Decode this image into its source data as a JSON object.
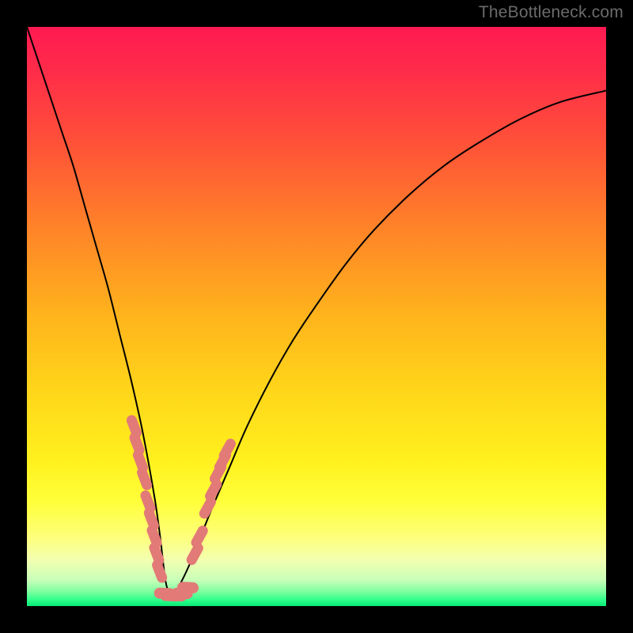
{
  "watermark": "TheBottleneck.com",
  "gradient_stops": [
    {
      "offset": 0,
      "color": "#ff1a52"
    },
    {
      "offset": 0.07,
      "color": "#ff2a4a"
    },
    {
      "offset": 0.2,
      "color": "#ff5138"
    },
    {
      "offset": 0.35,
      "color": "#ff8428"
    },
    {
      "offset": 0.5,
      "color": "#ffb41c"
    },
    {
      "offset": 0.63,
      "color": "#ffd61a"
    },
    {
      "offset": 0.75,
      "color": "#fff11e"
    },
    {
      "offset": 0.82,
      "color": "#ffff3a"
    },
    {
      "offset": 0.88,
      "color": "#feff7a"
    },
    {
      "offset": 0.92,
      "color": "#f3ffb0"
    },
    {
      "offset": 0.955,
      "color": "#c8ffb8"
    },
    {
      "offset": 0.975,
      "color": "#7dffa0"
    },
    {
      "offset": 0.99,
      "color": "#2cff8a"
    },
    {
      "offset": 1.0,
      "color": "#08e874"
    }
  ],
  "curve_color": "#000000",
  "curve_width": 2.0,
  "marker_color": "#e27a77",
  "chart_data": {
    "type": "line",
    "title": "",
    "xlabel": "",
    "ylabel": "",
    "xlim": [
      0,
      100
    ],
    "ylim": [
      0,
      100
    ],
    "notes": "Axes unlabeled; values are percent of plot width/height estimated from pixels. Vertical gradient encodes y-value (red high → green low). Single black curve descends from top-left corner to a minimum near x≈24 then rises asymptotically toward upper right. Salmon markers cluster along the curve near the bottom.",
    "series": [
      {
        "name": "curve",
        "x": [
          0,
          2,
          4,
          6,
          8,
          10,
          12,
          14,
          16,
          18,
          20,
          22,
          23,
          24,
          25,
          26,
          28,
          30,
          32,
          35,
          38,
          42,
          46,
          50,
          55,
          60,
          66,
          72,
          78,
          85,
          92,
          100
        ],
        "y": [
          100,
          94,
          88,
          82,
          76,
          69,
          62,
          55,
          47,
          39,
          30,
          19,
          12,
          4,
          2,
          3,
          7,
          12,
          17,
          24,
          31,
          39,
          46,
          52,
          59,
          65,
          71,
          76,
          80,
          84,
          87,
          89
        ]
      }
    ],
    "markers_left": [
      {
        "x": 18.5,
        "y": 31
      },
      {
        "x": 19.0,
        "y": 28
      },
      {
        "x": 19.6,
        "y": 25
      },
      {
        "x": 20.3,
        "y": 22
      },
      {
        "x": 20.9,
        "y": 18
      },
      {
        "x": 21.5,
        "y": 15
      },
      {
        "x": 22.0,
        "y": 12
      },
      {
        "x": 22.4,
        "y": 9
      },
      {
        "x": 22.9,
        "y": 6
      }
    ],
    "markers_bottom": [
      {
        "x": 23.8,
        "y": 2.2
      },
      {
        "x": 24.8,
        "y": 1.8
      },
      {
        "x": 25.8,
        "y": 1.8
      },
      {
        "x": 26.8,
        "y": 2.2
      },
      {
        "x": 27.8,
        "y": 3.2
      }
    ],
    "markers_right": [
      {
        "x": 29.0,
        "y": 9
      },
      {
        "x": 29.8,
        "y": 12
      },
      {
        "x": 31.2,
        "y": 17
      },
      {
        "x": 32.2,
        "y": 20
      },
      {
        "x": 33.0,
        "y": 23
      },
      {
        "x": 33.8,
        "y": 25
      },
      {
        "x": 34.6,
        "y": 27
      }
    ]
  }
}
